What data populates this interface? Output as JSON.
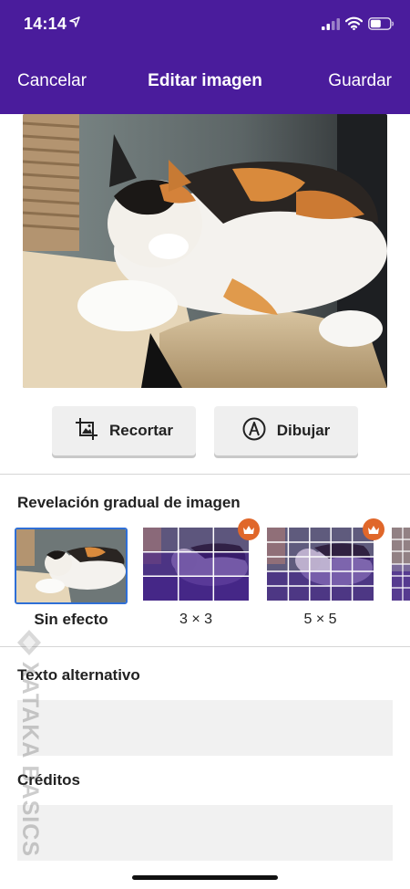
{
  "status_bar": {
    "time": "14:14",
    "icons": [
      "location-arrow-icon",
      "signal-icon",
      "wifi-icon",
      "battery-icon"
    ]
  },
  "nav": {
    "cancel": "Cancelar",
    "title": "Editar imagen",
    "save": "Guardar"
  },
  "colors": {
    "header": "#4a1c9c",
    "crown": "#e0672a",
    "selected_border": "#2f6fd6",
    "field": "#f1f1f1"
  },
  "tools": {
    "crop": "Recortar",
    "draw": "Dibujar"
  },
  "reveal": {
    "title": "Revelación gradual de imagen",
    "options": [
      {
        "label": "Sin efecto",
        "selected": true,
        "premium": false
      },
      {
        "label": "3 × 3",
        "selected": false,
        "premium": true
      },
      {
        "label": "5 × 5",
        "selected": false,
        "premium": true
      }
    ]
  },
  "alt_text": {
    "label": "Texto alternativo",
    "value": ""
  },
  "credits": {
    "label": "Créditos",
    "value": ""
  },
  "watermark": "XATAKA BASICS"
}
